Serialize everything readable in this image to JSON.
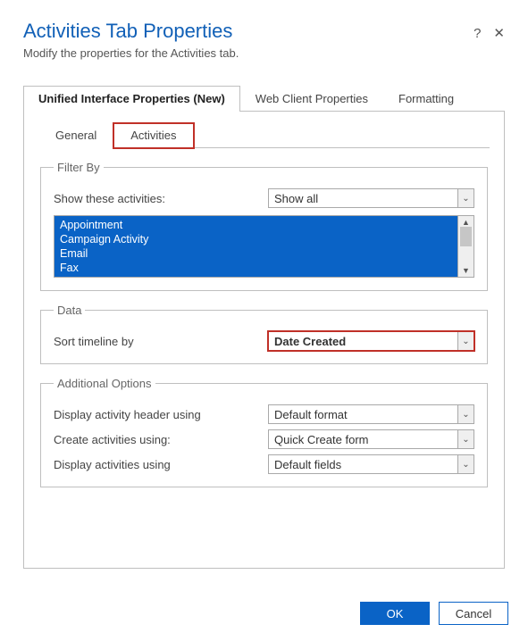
{
  "header": {
    "title": "Activities Tab Properties",
    "subtitle": "Modify the properties for the Activities tab.",
    "help_glyph": "?",
    "close_glyph": "✕"
  },
  "top_tabs": {
    "items": [
      {
        "label": "Unified Interface Properties (New)"
      },
      {
        "label": "Web Client Properties"
      },
      {
        "label": "Formatting"
      }
    ]
  },
  "sub_tabs": {
    "items": [
      {
        "label": "General"
      },
      {
        "label": "Activities"
      }
    ]
  },
  "filter_by": {
    "legend": "Filter By",
    "show_label": "Show these activities:",
    "show_value": "Show all",
    "list": [
      "Appointment",
      "Campaign Activity",
      "Email",
      "Fax"
    ]
  },
  "data_section": {
    "legend": "Data",
    "sort_label": "Sort timeline by",
    "sort_value": "Date Created"
  },
  "additional": {
    "legend": "Additional Options",
    "header_label": "Display activity header using",
    "header_value": "Default format",
    "create_label": "Create activities using:",
    "create_value": "Quick Create form",
    "display_label": "Display activities using",
    "display_value": "Default fields"
  },
  "footer": {
    "ok": "OK",
    "cancel": "Cancel"
  },
  "glyphs": {
    "chev_down": "⌄",
    "tri_up": "▲",
    "tri_down": "▼"
  }
}
